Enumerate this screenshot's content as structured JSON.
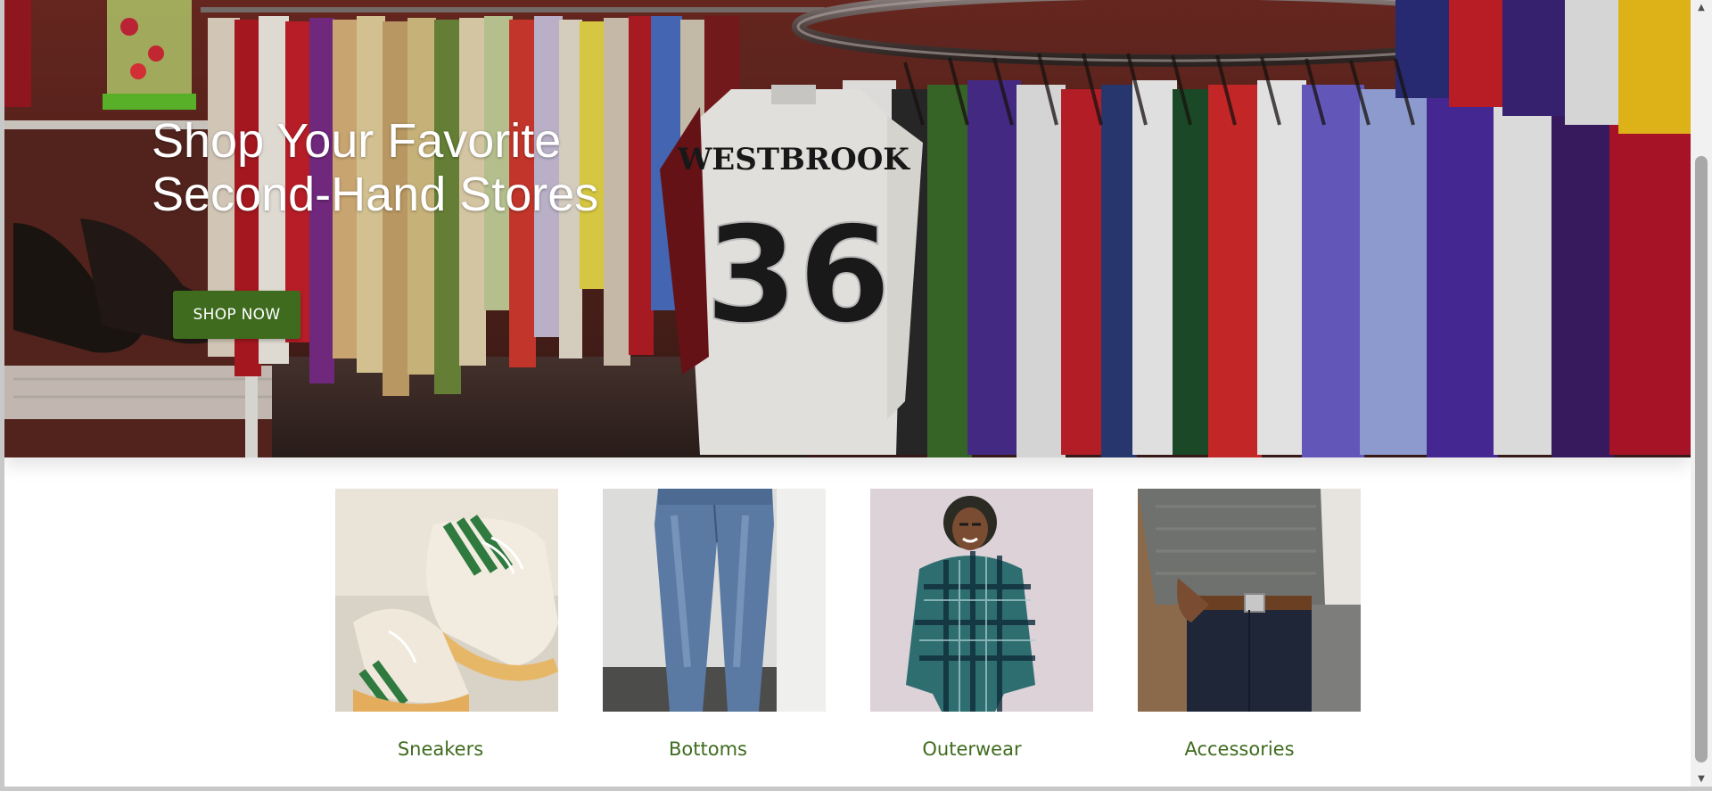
{
  "hero": {
    "title_line1": "Shop Your Favorite",
    "title_line2": "Second-Hand Stores",
    "button_label": "SHOP NOW",
    "jersey_name": "WESTBROOK",
    "jersey_number": "36"
  },
  "categories": [
    {
      "label": "Sneakers"
    },
    {
      "label": "Bottoms"
    },
    {
      "label": "Outerwear"
    },
    {
      "label": "Accessories"
    }
  ],
  "colors": {
    "accent": "#3f6b1f",
    "hero_text": "#ffffff",
    "page_bg": "#ffffff"
  },
  "scrollbar": {
    "up_icon": "chevron-up-icon",
    "down_icon": "chevron-down-icon"
  }
}
